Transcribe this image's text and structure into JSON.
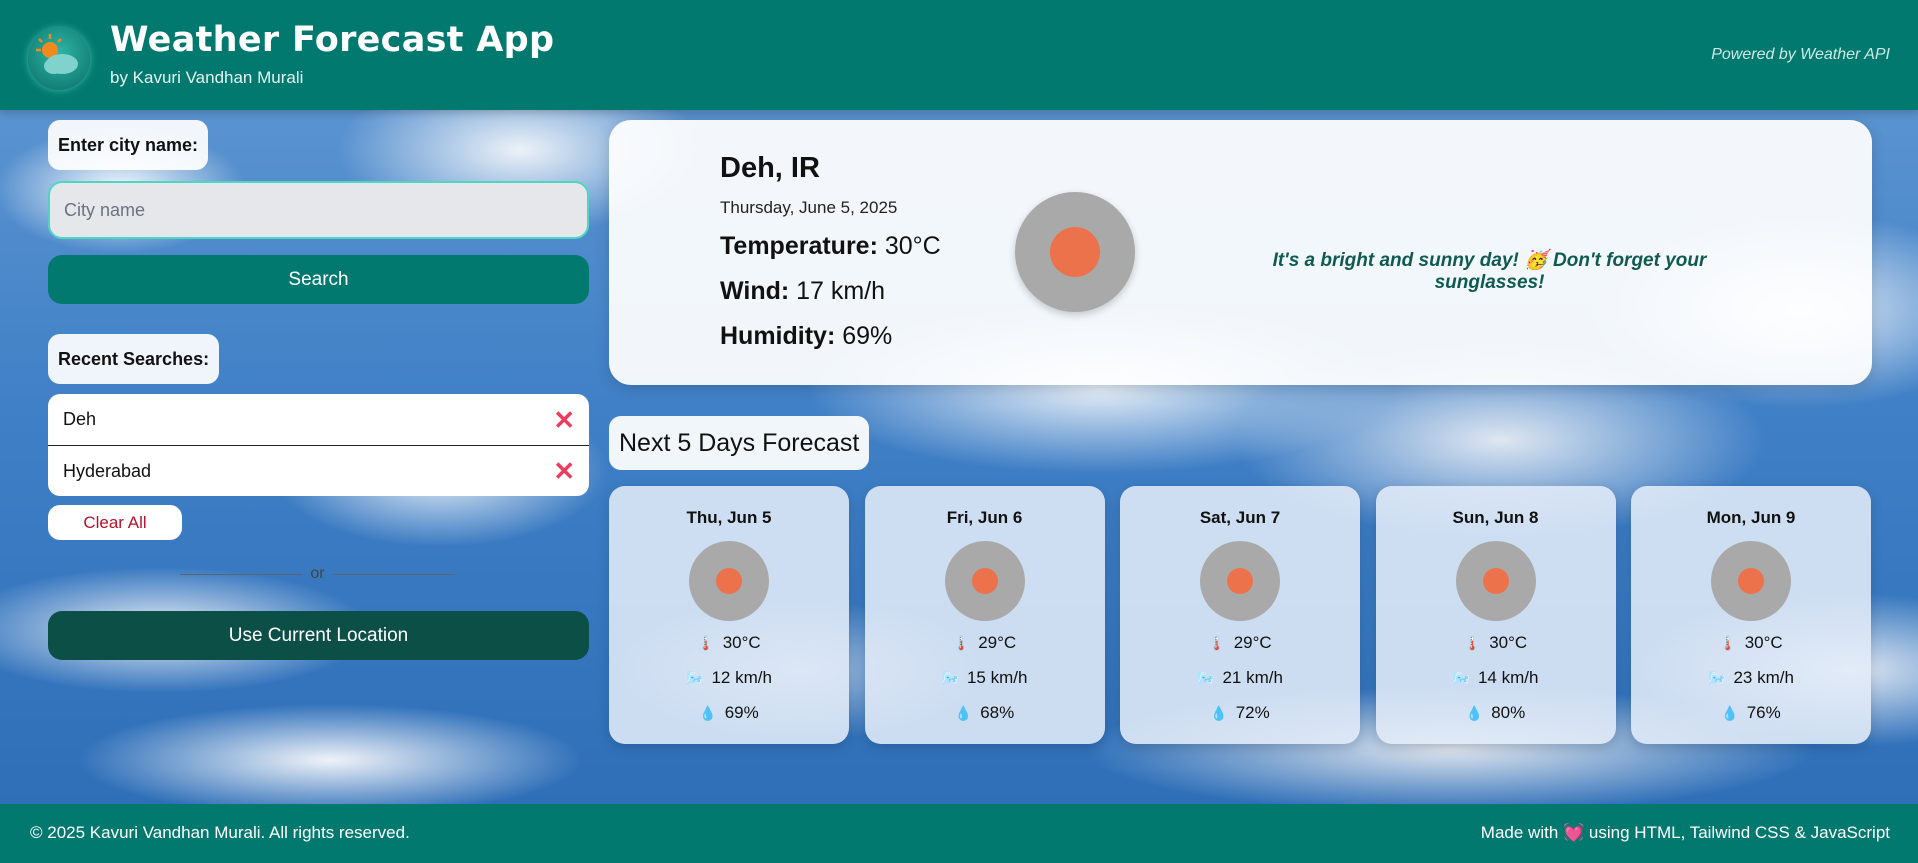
{
  "header": {
    "title": "Weather Forecast App",
    "subtitle": "by Kavuri Vandhan Murali",
    "powered": "Powered by Weather API"
  },
  "search": {
    "label": "Enter city name:",
    "placeholder": "City name",
    "value": "",
    "button": "Search"
  },
  "recent": {
    "label": "Recent Searches:",
    "items": [
      {
        "name": "Deh"
      },
      {
        "name": "Hyderabad"
      }
    ],
    "clear_label": "Clear All"
  },
  "divider": "or",
  "location_button": "Use Current Location",
  "current": {
    "city": "Deh, IR",
    "date": "Thursday, June 5, 2025",
    "temp_label": "Temperature:",
    "temp": "30°C",
    "wind_label": "Wind:",
    "wind": "17 km/h",
    "humidity_label": "Humidity:",
    "humidity": "69%",
    "icon": "sun-icon",
    "message": "It's a bright and sunny day! 🥳 Don't forget your sunglasses!"
  },
  "forecast": {
    "title": "Next 5 Days Forecast",
    "days": [
      {
        "day": "Thu, Jun 5",
        "temp": "30°C",
        "wind": "12 km/h",
        "humidity": "69%"
      },
      {
        "day": "Fri, Jun 6",
        "temp": "29°C",
        "wind": "15 km/h",
        "humidity": "68%"
      },
      {
        "day": "Sat, Jun 7",
        "temp": "29°C",
        "wind": "21 km/h",
        "humidity": "72%"
      },
      {
        "day": "Sun, Jun 8",
        "temp": "30°C",
        "wind": "14 km/h",
        "humidity": "80%"
      },
      {
        "day": "Mon, Jun 9",
        "temp": "30°C",
        "wind": "23 km/h",
        "humidity": "76%"
      }
    ],
    "icons": {
      "temp": "thermometer-icon",
      "wind": "wind-icon",
      "humidity": "droplet-icon"
    }
  },
  "footer": {
    "copyright": "© 2025 Kavuri Vandhan Murali. All rights reserved.",
    "made_prefix": "Made with",
    "made_suffix": "using HTML, Tailwind CSS & JavaScript"
  },
  "colors": {
    "brand": "#02796f",
    "brand_dark": "#0b4f47",
    "accent_remove": "#ef3b5c",
    "sun": "#ec724c"
  }
}
